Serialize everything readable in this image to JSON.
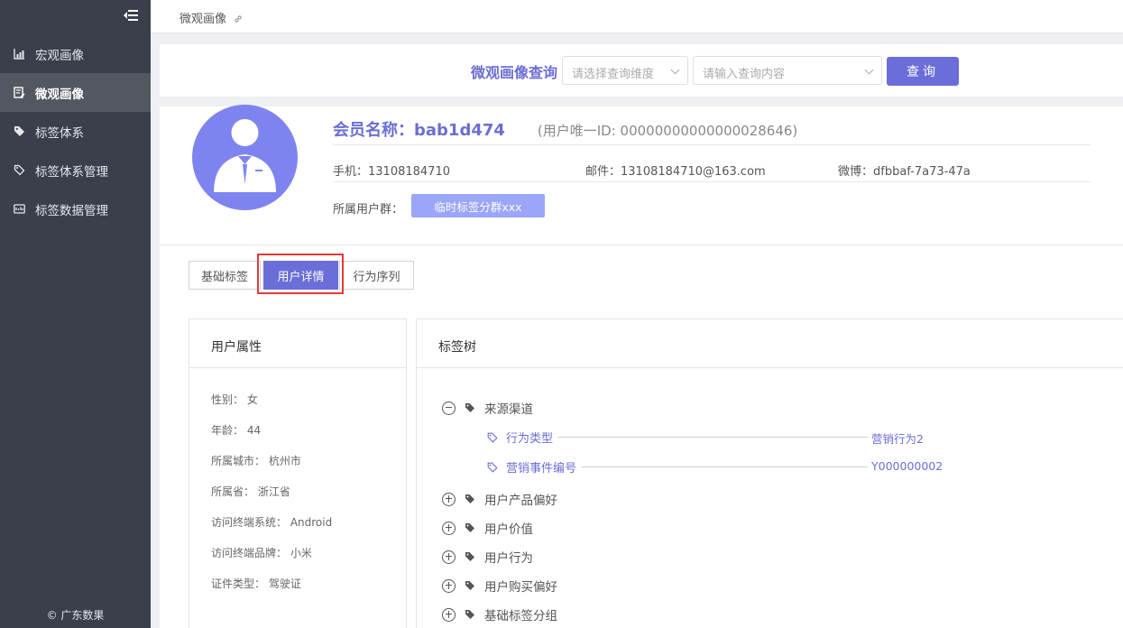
{
  "sidebar": {
    "items": [
      {
        "label": "宏观画像",
        "icon": "chart-icon",
        "active": false
      },
      {
        "label": "微观画像",
        "icon": "profile-icon",
        "active": true
      },
      {
        "label": "标签体系",
        "icon": "tag-icon",
        "active": false
      },
      {
        "label": "标签体系管理",
        "icon": "tag-outline-icon",
        "active": false
      },
      {
        "label": "标签数据管理",
        "icon": "dashboard-icon",
        "active": false
      }
    ],
    "footer": "© 广东数果"
  },
  "topbar": {
    "breadcrumb": "微观画像"
  },
  "search": {
    "title": "微观画像查询",
    "dimension_placeholder": "请选择查询维度",
    "content_placeholder": "请输入查询内容",
    "button_label": "查询"
  },
  "profile": {
    "member_name": "会员名称：bab1d474",
    "unique_id": "(用户唯一ID: 00000000000000028646)",
    "phone": "手机：13108184710",
    "email": "邮件：13108184710@163.com",
    "weibo": "微博：dfbbaf-7a73-47a",
    "group_label": "所属用户群：",
    "group_value": "临时标签分群xxx"
  },
  "tabs": [
    {
      "label": "基础标签",
      "active": false
    },
    {
      "label": "用户详情",
      "active": true
    },
    {
      "label": "行为序列",
      "active": false
    }
  ],
  "attributes": {
    "title": "用户属性",
    "items": [
      "性别： 女",
      "年龄： 44",
      "所属城市： 杭州市",
      "所属省： 浙江省",
      "访问终端系统： Android",
      "访问终端品牌： 小米",
      "证件类型： 驾驶证"
    ]
  },
  "tag_tree": {
    "title": "标签树",
    "expanded": {
      "label": "来源渠道",
      "children": [
        {
          "label": "行为类型",
          "value": "营销行为2"
        },
        {
          "label": "营销事件编号",
          "value": "Y000000002"
        }
      ]
    },
    "collapsed": [
      "用户产品偏好",
      "用户价值",
      "用户行为",
      "用户购买偏好",
      "基础标签分组"
    ]
  },
  "colors": {
    "accent": "#6b6ed8",
    "sidebar": "#3b3f4b",
    "badge": "#99a6fa",
    "highlight": "#e53a3a"
  }
}
